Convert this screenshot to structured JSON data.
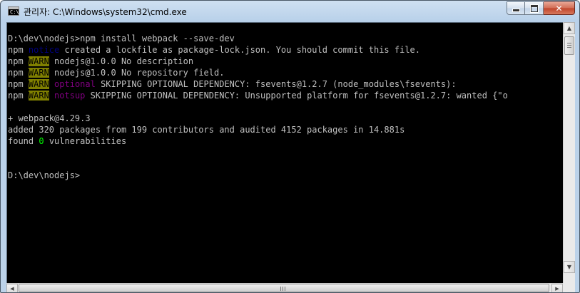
{
  "window": {
    "title": "관리자: C:\\Windows\\system32\\cmd.exe",
    "icon": "cmd-icon",
    "icon_glyph": "C:\\",
    "buttons": {
      "minimize": "minimize-icon",
      "maximize": "maximize-icon",
      "close": "✕"
    }
  },
  "console": {
    "lines": [
      {
        "segments": [
          {
            "text": "D:\\dev\\nodejs>npm install webpack --save-dev",
            "style": "normal"
          }
        ]
      },
      {
        "segments": [
          {
            "text": "npm ",
            "style": "normal"
          },
          {
            "text": "notice",
            "style": "notice"
          },
          {
            "text": " created a lockfile as package-lock.json. You should commit this file.",
            "style": "normal"
          }
        ]
      },
      {
        "segments": [
          {
            "text": "npm ",
            "style": "normal"
          },
          {
            "text": "WARN",
            "style": "warn"
          },
          {
            "text": " nodejs@1.0.0 No description",
            "style": "normal"
          }
        ]
      },
      {
        "segments": [
          {
            "text": "npm ",
            "style": "normal"
          },
          {
            "text": "WARN",
            "style": "warn"
          },
          {
            "text": " nodejs@1.0.0 No repository field.",
            "style": "normal"
          }
        ]
      },
      {
        "segments": [
          {
            "text": "npm ",
            "style": "normal"
          },
          {
            "text": "WARN",
            "style": "warn"
          },
          {
            "text": " ",
            "style": "normal"
          },
          {
            "text": "optional",
            "style": "optional"
          },
          {
            "text": " SKIPPING OPTIONAL DEPENDENCY: fsevents@1.2.7 (node_modules\\fsevents):",
            "style": "normal"
          }
        ]
      },
      {
        "segments": [
          {
            "text": "npm ",
            "style": "normal"
          },
          {
            "text": "WARN",
            "style": "warn"
          },
          {
            "text": " ",
            "style": "normal"
          },
          {
            "text": "notsup",
            "style": "notsup"
          },
          {
            "text": " SKIPPING OPTIONAL DEPENDENCY: Unsupported platform for fsevents@1.2.7: wanted {\"o",
            "style": "normal"
          }
        ]
      },
      {
        "segments": [
          {
            "text": "",
            "style": "normal"
          }
        ]
      },
      {
        "segments": [
          {
            "text": "+ webpack@4.29.3",
            "style": "normal"
          }
        ]
      },
      {
        "segments": [
          {
            "text": "added 320 packages from 199 contributors and audited 4152 packages in 14.881s",
            "style": "normal"
          }
        ]
      },
      {
        "segments": [
          {
            "text": "found ",
            "style": "normal"
          },
          {
            "text": "0",
            "style": "green"
          },
          {
            "text": " vulnerabilities",
            "style": "normal"
          }
        ]
      },
      {
        "segments": [
          {
            "text": "",
            "style": "normal"
          }
        ]
      },
      {
        "segments": [
          {
            "text": "",
            "style": "normal"
          }
        ]
      },
      {
        "segments": [
          {
            "text": "D:\\dev\\nodejs>",
            "style": "normal"
          }
        ]
      }
    ]
  },
  "scrollbars": {
    "vertical": {
      "up": "▲",
      "down": "▼"
    },
    "horizontal": {
      "left": "◀",
      "right": "▶"
    }
  },
  "colors": {
    "warn_bg": "#808000",
    "notice": "#000080",
    "optional": "#800080",
    "green": "#00ff00",
    "console_fg": "#c0c0c0",
    "console_bg": "#000000"
  }
}
